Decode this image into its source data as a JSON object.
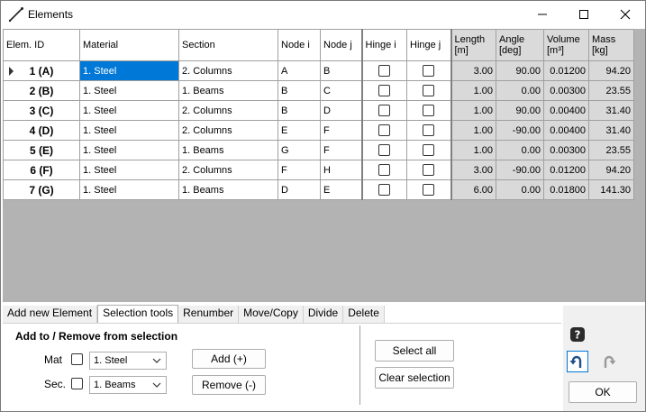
{
  "window": {
    "title": "Elements",
    "minimize_icon": "minimize-icon",
    "maximize_icon": "maximize-icon",
    "close_icon": "close-icon"
  },
  "grid": {
    "headers": {
      "elem_id": "Elem. ID",
      "material": "Material",
      "section": "Section",
      "node_i": "Node i",
      "node_j": "Node j",
      "hinge_i": "Hinge i",
      "hinge_j": "Hinge j",
      "length": "Length",
      "length_unit": "[m]",
      "angle": "Angle",
      "angle_unit": "[deg]",
      "volume": "Volume",
      "volume_unit": "[m³]",
      "mass": "Mass",
      "mass_unit": "[kg]"
    },
    "rows": [
      {
        "id": "1 (A)",
        "material": "1. Steel",
        "section": "2. Columns",
        "node_i": "A",
        "node_j": "B",
        "hinge_i": false,
        "hinge_j": false,
        "length": "3.00",
        "angle": "90.00",
        "volume": "0.01200",
        "mass": "94.20"
      },
      {
        "id": "2 (B)",
        "material": "1. Steel",
        "section": "1. Beams",
        "node_i": "B",
        "node_j": "C",
        "hinge_i": false,
        "hinge_j": false,
        "length": "1.00",
        "angle": "0.00",
        "volume": "0.00300",
        "mass": "23.55"
      },
      {
        "id": "3 (C)",
        "material": "1. Steel",
        "section": "2. Columns",
        "node_i": "B",
        "node_j": "D",
        "hinge_i": false,
        "hinge_j": false,
        "length": "1.00",
        "angle": "90.00",
        "volume": "0.00400",
        "mass": "31.40"
      },
      {
        "id": "4 (D)",
        "material": "1. Steel",
        "section": "2. Columns",
        "node_i": "E",
        "node_j": "F",
        "hinge_i": false,
        "hinge_j": false,
        "length": "1.00",
        "angle": "-90.00",
        "volume": "0.00400",
        "mass": "31.40"
      },
      {
        "id": "5 (E)",
        "material": "1. Steel",
        "section": "1. Beams",
        "node_i": "G",
        "node_j": "F",
        "hinge_i": false,
        "hinge_j": false,
        "length": "1.00",
        "angle": "0.00",
        "volume": "0.00300",
        "mass": "23.55"
      },
      {
        "id": "6 (F)",
        "material": "1. Steel",
        "section": "2. Columns",
        "node_i": "F",
        "node_j": "H",
        "hinge_i": false,
        "hinge_j": false,
        "length": "3.00",
        "angle": "-90.00",
        "volume": "0.01200",
        "mass": "94.20"
      },
      {
        "id": "7 (G)",
        "material": "1. Steel",
        "section": "1. Beams",
        "node_i": "D",
        "node_j": "E",
        "hinge_i": false,
        "hinge_j": false,
        "length": "6.00",
        "angle": "0.00",
        "volume": "0.01800",
        "mass": "141.30"
      }
    ],
    "selected_cell": {
      "row": 0,
      "column": "material"
    },
    "selection_color": "#0078d7"
  },
  "tabs": [
    {
      "label": "Add new Element",
      "active": false
    },
    {
      "label": "Selection tools",
      "active": true
    },
    {
      "label": "Renumber",
      "active": false
    },
    {
      "label": "Move/Copy",
      "active": false
    },
    {
      "label": "Divide",
      "active": false
    },
    {
      "label": "Delete",
      "active": false
    }
  ],
  "selection_panel": {
    "title": "Add to / Remove from selection",
    "mat_label": "Mat",
    "mat_checked": false,
    "mat_value": "1. Steel",
    "sec_label": "Sec.",
    "sec_checked": false,
    "sec_value": "1. Beams",
    "add_label": "Add (+)",
    "remove_label": "Remove (-)",
    "select_all_label": "Select all",
    "clear_selection_label": "Clear selection"
  },
  "side": {
    "help_icon": "help-icon",
    "undo_icon": "undo-icon",
    "redo_icon": "redo-icon",
    "ok_label": "OK"
  }
}
